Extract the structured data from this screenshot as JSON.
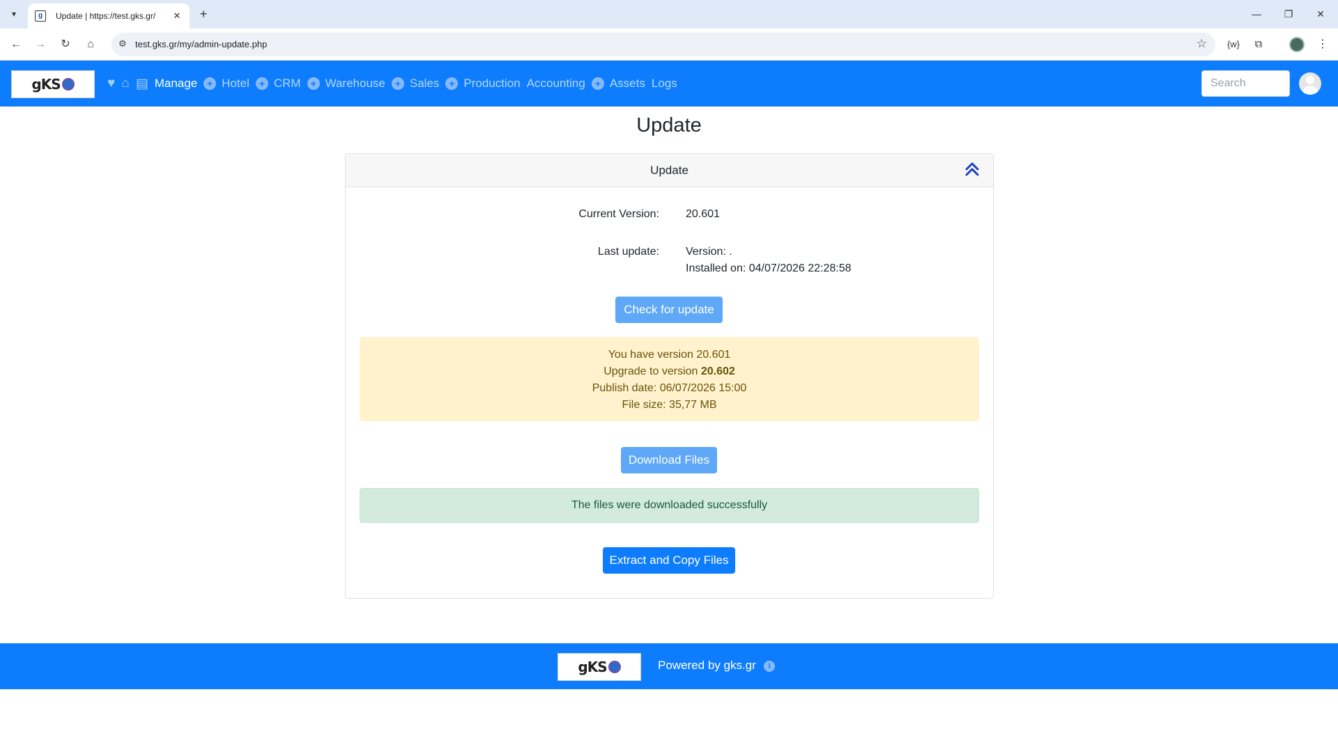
{
  "browser": {
    "tab_title": "Update | https://test.gks.gr/",
    "url": "test.gks.gr/my/admin-update.php"
  },
  "icons": {
    "tab_menu": "chevron-down-icon",
    "favicon": "site-favicon",
    "tab_close": "close-icon",
    "new_tab": "plus-icon",
    "back": "arrow-left-icon",
    "forward": "arrow-right-icon",
    "reload": "reload-icon",
    "home": "home-icon",
    "site_info": "tune-icon",
    "bookmark": "star-icon",
    "extension": "puzzle-icon",
    "menu": "kebab-menu-icon",
    "favorite": "heart-icon",
    "collapse": "double-chevron-up-icon",
    "info": "info-icon"
  },
  "navbar": {
    "logo_text": "gKS",
    "items": [
      {
        "label": "Manage",
        "active": true,
        "plus": false
      },
      {
        "label": "Hotel",
        "active": false,
        "plus": true
      },
      {
        "label": "CRM",
        "active": false,
        "plus": true
      },
      {
        "label": "Warehouse",
        "active": false,
        "plus": true
      },
      {
        "label": "Sales",
        "active": false,
        "plus": true
      },
      {
        "label": "Production",
        "active": false,
        "plus": true
      },
      {
        "label": "Accounting",
        "active": false,
        "plus": false
      },
      {
        "label": "Assets",
        "active": false,
        "plus": true
      },
      {
        "label": "Logs",
        "active": false,
        "plus": false
      }
    ],
    "search_placeholder": "Search"
  },
  "page": {
    "title": "Update",
    "card_title": "Update",
    "current_version_label": "Current Version:",
    "current_version_value": "20.601",
    "last_update_label": "Last update:",
    "last_update_version": "Version: .",
    "last_update_installed": "Installed on: 04/07/2026 22:28:58",
    "check_button": "Check for update",
    "warning": {
      "line1": "You have version 20.601",
      "line2_prefix": "Upgrade to version ",
      "line2_version": "20.602",
      "line3": "Publish date: 06/07/2026 15:00",
      "line4": "File size: 35,77 MB"
    },
    "download_button": "Download Files",
    "success_message": "The files were downloaded successfully",
    "extract_button": "Extract and Copy Files"
  },
  "footer": {
    "logo_text": "gKS",
    "powered_by": "Powered by gks.gr"
  },
  "colors": {
    "brand": "#0d7dfd",
    "button_light": "#5ea8f7",
    "warning_bg": "#fff2cd",
    "success_bg": "#d3ebdc"
  }
}
